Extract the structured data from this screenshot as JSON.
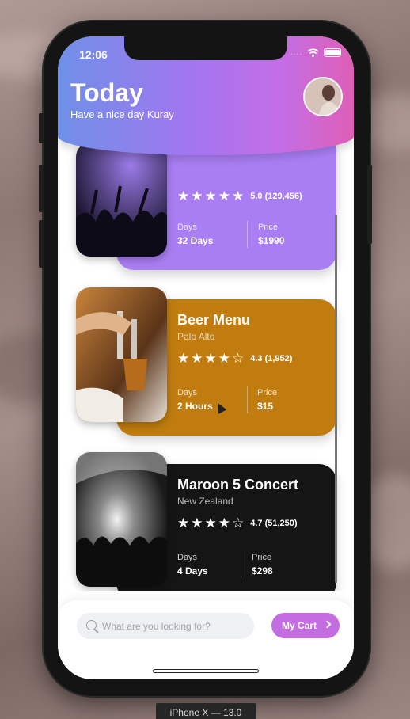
{
  "device": {
    "label": "iPhone X — 13.0"
  },
  "status_bar": {
    "time": "12:06",
    "signal": "....",
    "wifi_icon": "wifi-icon",
    "battery_icon": "battery-icon"
  },
  "header": {
    "title": "Today",
    "subtitle": "Have a nice day Kuray",
    "avatar_icon": "avatar"
  },
  "cards": [
    {
      "name": "",
      "location": "",
      "rating": "5.0 (129,456)",
      "stars_filled": 5,
      "days_label": "Days",
      "days_value": "32 Days",
      "price_label": "Price",
      "price_value": "$1990",
      "color": "#a97ef3"
    },
    {
      "name": "Beer Menu",
      "location": "Palo Alto",
      "rating": "4.3 (1,952)",
      "stars_filled": 4,
      "days_label": "Days",
      "days_value": "2 Hours",
      "price_label": "Price",
      "price_value": "$15",
      "color": "#c07c0e"
    },
    {
      "name": "Maroon 5 Concert",
      "location": "New Zealand",
      "rating": "4.7 (51,250)",
      "stars_filled": 4,
      "days_label": "Days",
      "days_value": "4 Days",
      "price_label": "Price",
      "price_value": "$298",
      "color": "#151515"
    }
  ],
  "search": {
    "placeholder": "What are you looking for?"
  },
  "cart": {
    "label": "My Cart"
  }
}
